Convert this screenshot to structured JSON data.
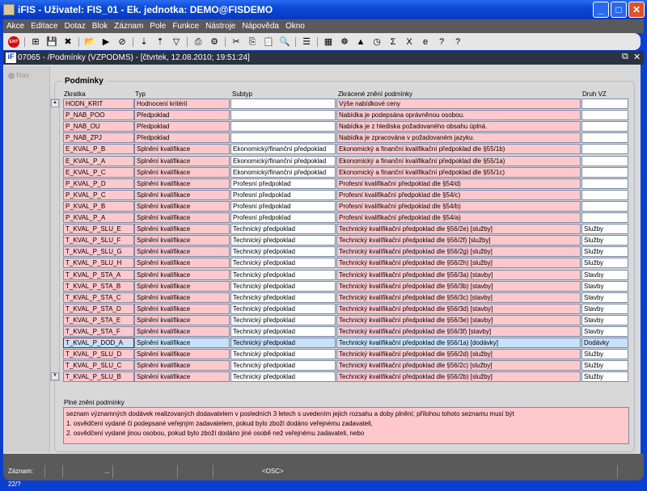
{
  "window": {
    "title": "iFIS - Uživatel: FIS_01 - Ek. jednotka: DEMO@FISDEMO"
  },
  "menu": [
    "Akce",
    "Editace",
    "Dotaz",
    "Blok",
    "Záznam",
    "Pole",
    "Funkce",
    "Nástroje",
    "Nápověda",
    "Okno"
  ],
  "toolbar_icons": [
    "exit-icon",
    "insert-record-icon",
    "save-icon",
    "delete-record-icon",
    "enter-query-icon",
    "execute-query-icon",
    "cancel-query-icon",
    "sort-asc-icon",
    "sort-desc-icon",
    "filter-icon",
    "print-icon",
    "print-setup-icon",
    "cut-icon",
    "copy-icon",
    "paste-icon",
    "search-icon",
    "list-icon",
    "calendar-icon",
    "settings-icon",
    "tree-icon",
    "clock-icon",
    "sum-icon",
    "excel-icon",
    "browser-icon",
    "help-icon",
    "context-help-icon"
  ],
  "form": {
    "title": "07065 - /Podmínky (VZPODMS) - [čtvrtek, 12.08.2010; 19:51:24]",
    "nav": "Nav",
    "group": "Podmínky",
    "columns": [
      "Zkratka",
      "Typ",
      "Subtyp",
      "Zkrácené znění podmínky",
      "Druh VZ"
    ],
    "rows": [
      [
        "HODN_KRIT",
        "Hodnocení kritérií",
        "",
        "Výše nabídkové ceny",
        ""
      ],
      [
        "P_NAB_POO",
        "Předpoklad",
        "",
        "Nabídka je podepsána oprávněnou osobou.",
        ""
      ],
      [
        "P_NAB_OU",
        "Předpoklad",
        "",
        "Nabídka je z hlediska požadovaného obsahu úplná.",
        ""
      ],
      [
        "P_NAB_ZPJ",
        "Předpoklad",
        "",
        "Nabídka je zpracována v požadovaném jazyku.",
        ""
      ],
      [
        "E_KVAL_P_B",
        "Splnění kvalifikace",
        "Ekonomický/finanční předpoklad",
        "Ekonomický a finanční kvalifikační předpoklad dle §55/1b)",
        ""
      ],
      [
        "E_KVAL_P_A",
        "Splnění kvalifikace",
        "Ekonomický/finanční předpoklad",
        "Ekonomický a finanční kvalifikační předpoklad dle §55/1a)",
        ""
      ],
      [
        "E_KVAL_P_C",
        "Splnění kvalifikace",
        "Ekonomický/finanční předpoklad",
        "Ekonomický a finanční kvalifikační předpoklad dle §55/1c)",
        ""
      ],
      [
        "P_KVAL_P_D",
        "Splnění kvalifikace",
        "Profesní předpoklad",
        "Profesní kvalifikační předpoklad dle §54/d)",
        ""
      ],
      [
        "P_KVAL_P_C",
        "Splnění kvalifikace",
        "Profesní předpoklad",
        "Profesní kvalifikační předpoklad dle §54/c)",
        ""
      ],
      [
        "P_KVAL_P_B",
        "Splnění kvalifikace",
        "Profesní předpoklad",
        "Profesní kvalifikační předpoklad dle §54/b)",
        ""
      ],
      [
        "P_KVAL_P_A",
        "Splnění kvalifikace",
        "Profesní předpoklad",
        "Profesní kvalifikační předpoklad dle §54/a)",
        ""
      ],
      [
        "T_KVAL_P_SLU_E",
        "Splnění kvalifikace",
        "Technický předpoklad",
        "Technický kvalifikační předpoklad dle §56/2e) [služby]",
        "Služby"
      ],
      [
        "T_KVAL_P_SLU_F",
        "Splnění kvalifikace",
        "Technický předpoklad",
        "Technický kvalifikační předpoklad dle §56/2f) [služby]",
        "Služby"
      ],
      [
        "T_KVAL_P_SLU_G",
        "Splnění kvalifikace",
        "Technický předpoklad",
        "Technický kvalifikační předpoklad dle §56/2g) [služby]",
        "Služby"
      ],
      [
        "T_KVAL_P_SLU_H",
        "Splnění kvalifikace",
        "Technický předpoklad",
        "Technický kvalifikační předpoklad dle §56/2h) [služby]",
        "Služby"
      ],
      [
        "T_KVAL_P_STA_A",
        "Splnění kvalifikace",
        "Technický předpoklad",
        "Technický kvalifikační předpoklad dle §56/3a) [stavby]",
        "Stavby"
      ],
      [
        "T_KVAL_P_STA_B",
        "Splnění kvalifikace",
        "Technický předpoklad",
        "Technický kvalifikační předpoklad dle §56/3b) [stavby]",
        "Stavby"
      ],
      [
        "T_KVAL_P_STA_C",
        "Splnění kvalifikace",
        "Technický předpoklad",
        "Technický kvalifikační předpoklad dle §56/3c) [stavby]",
        "Stavby"
      ],
      [
        "T_KVAL_P_STA_D",
        "Splnění kvalifikace",
        "Technický předpoklad",
        "Technický kvalifikační předpoklad dle §56/3d) [stavby]",
        "Stavby"
      ],
      [
        "T_KVAL_P_STA_E",
        "Splnění kvalifikace",
        "Technický předpoklad",
        "Technický kvalifikační předpoklad dle §56/3e) [stavby]",
        "Stavby"
      ],
      [
        "T_KVAL_P_STA_F",
        "Splnění kvalifikace",
        "Technický předpoklad",
        "Technický kvalifikační předpoklad dle §56/3f) [stavby]",
        "Stavby"
      ],
      [
        "T_KVAL_P_DOD_A",
        "Splnění kvalifikace",
        "Technický předpoklad",
        "Technický kvalifikační předpoklad dle §56/1a) [dodávky]",
        "Dodávky"
      ],
      [
        "T_KVAL_P_SLU_D",
        "Splnění kvalifikace",
        "Technický předpoklad",
        "Technický kvalifikační předpoklad dle §56/2d) [služby]",
        "Služby"
      ],
      [
        "T_KVAL_P_SLU_C",
        "Splnění kvalifikace",
        "Technický předpoklad",
        "Technický kvalifikační předpoklad dle §56/2c) [služby]",
        "Služby"
      ],
      [
        "T_KVAL_P_SLU_B",
        "Splnění kvalifikace",
        "Technický předpoklad",
        "Technický kvalifikační předpoklad dle §56/2b) [služby]",
        "Služby"
      ]
    ],
    "selected_row": 21,
    "full_label": "Plné znění podmínky",
    "full_text": [
      "seznam významných dodávek realizovaných dodavatelem v posledních 3 letech s uvedením jejich rozsahu a doby plnění; přílohou tohoto seznamu musí být",
      "1. osvědčení vydané či podepsané veřejným zadavatelem, pokud bylo zboží dodáno veřejnému zadavateli,",
      "2. osvědčení vydané jinou osobou, pokud bylo zboží dodáno jiné osobě než veřejnému zadavateli, nebo"
    ]
  },
  "status": {
    "record": "Záznam: 22/?",
    "ellipsis": "...",
    "mode": "<OSC>"
  }
}
